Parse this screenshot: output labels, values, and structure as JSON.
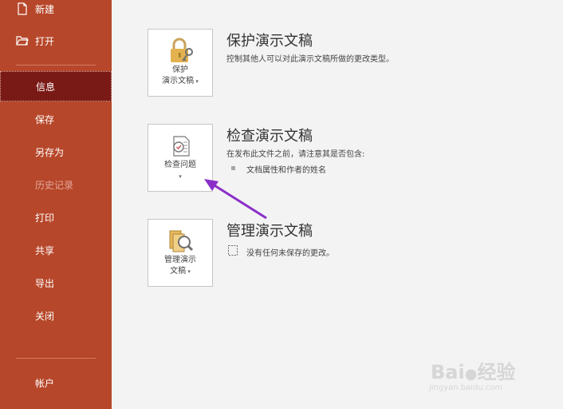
{
  "sidebar": {
    "items": [
      {
        "label": "新建",
        "icon": "new-file-icon"
      },
      {
        "label": "打开",
        "icon": "open-folder-icon"
      },
      {
        "label": "信息"
      },
      {
        "label": "保存"
      },
      {
        "label": "另存为"
      },
      {
        "label": "历史记录"
      },
      {
        "label": "打印"
      },
      {
        "label": "共享"
      },
      {
        "label": "导出"
      },
      {
        "label": "关闭"
      },
      {
        "label": "帐户"
      }
    ]
  },
  "sections": {
    "protect": {
      "tile_line1": "保护",
      "tile_line2": "演示文稿",
      "title": "保护演示文稿",
      "desc": "控制其他人可以对此演示文稿所做的更改类型。",
      "icon": "lock-key-icon"
    },
    "inspect": {
      "tile_label": "检查问题",
      "title": "检查演示文稿",
      "desc": "在发布此文件之前，请注意其是否包含:",
      "bullet": "文档属性和作者的姓名",
      "icon": "inspect-document-icon"
    },
    "manage": {
      "tile_line1": "管理演示",
      "tile_line2": "文稿",
      "title": "管理演示文稿",
      "desc": "没有任何未保存的更改。",
      "icon": "manage-document-icon"
    }
  },
  "watermark": {
    "brand": "Bai",
    "brand_suffix": "经验",
    "url": "jingyan.baidu.com"
  },
  "colors": {
    "sidebar": "#b7472a",
    "sidebar_active": "#7a1a16",
    "arrow": "#8b2fc9"
  }
}
